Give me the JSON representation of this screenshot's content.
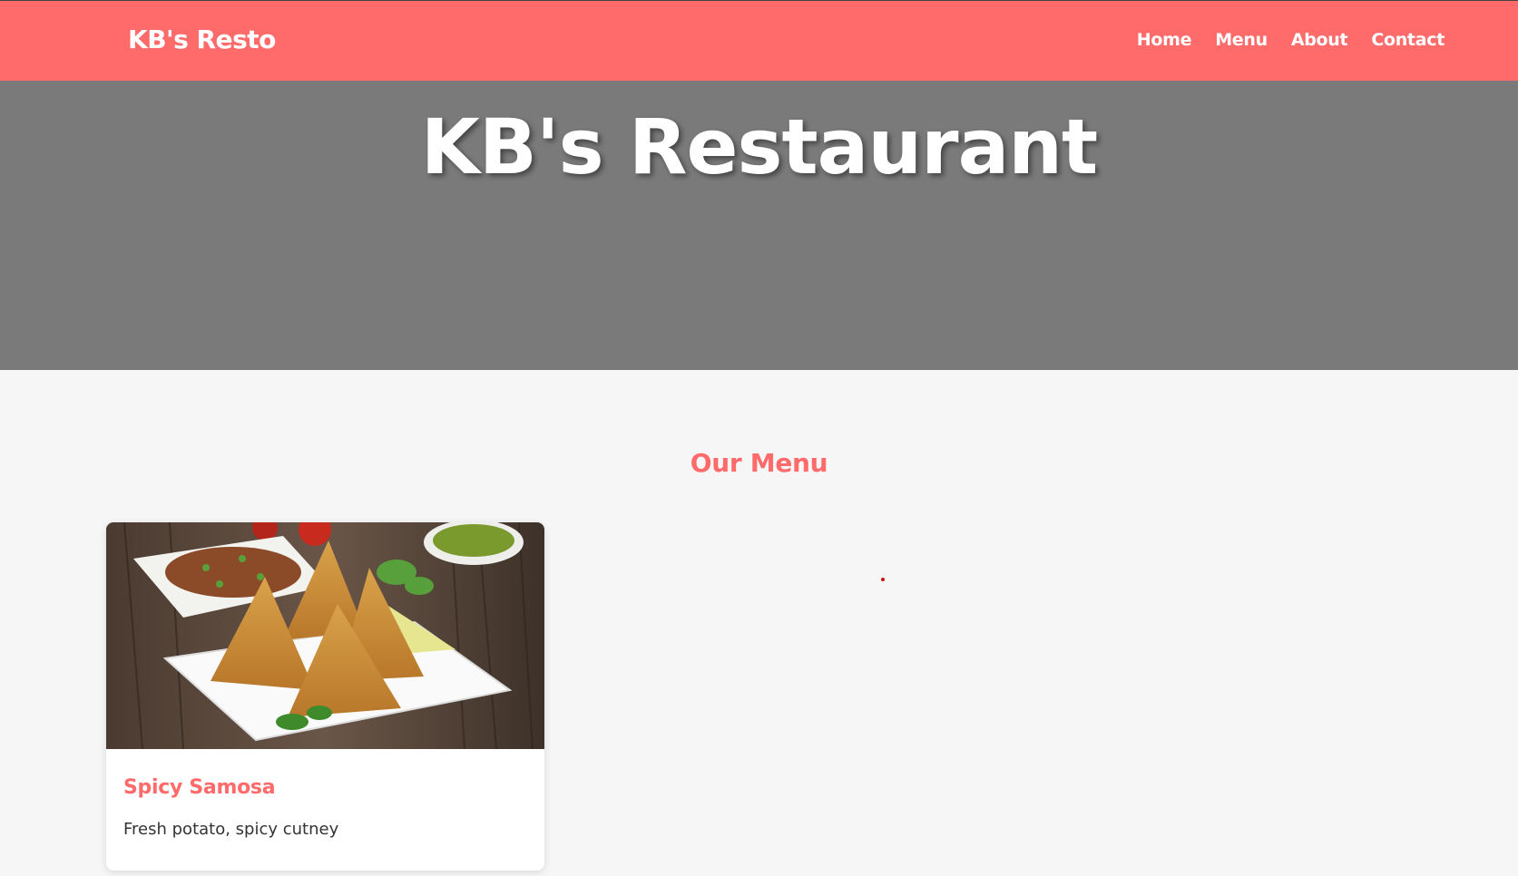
{
  "navbar": {
    "brand": "KB's Resto",
    "links": [
      {
        "label": "Home"
      },
      {
        "label": "Menu"
      },
      {
        "label": "About"
      },
      {
        "label": "Contact"
      }
    ],
    "background_color": "#ff6b6b"
  },
  "hero": {
    "title": "KB's Restaurant",
    "background_color": "#7a7a7a"
  },
  "menu": {
    "title": "Our Menu",
    "items": [
      {
        "image": "samosa-photo",
        "name": "Spicy Samosa",
        "description": "Fresh potato, spicy cutney"
      }
    ]
  },
  "colors": {
    "accent": "#ff6b6b",
    "page_background": "#f6f6f6"
  }
}
